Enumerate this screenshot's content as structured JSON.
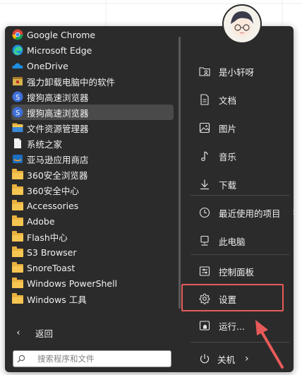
{
  "start_menu": {
    "apps": [
      {
        "label": "Google Chrome",
        "icon": "chrome-icon"
      },
      {
        "label": "Microsoft Edge",
        "icon": "edge-icon"
      },
      {
        "label": "OneDrive",
        "icon": "onedrive-icon"
      },
      {
        "label": "强力卸载电脑中的软件",
        "icon": "uninstall-icon"
      },
      {
        "label": "搜狗高速浏览器",
        "icon": "sogou-icon"
      },
      {
        "label": "搜狗高速浏览器",
        "icon": "sogou-icon",
        "selected": true
      },
      {
        "label": "文件资源管理器",
        "icon": "file-explorer-icon"
      },
      {
        "label": "系统之家",
        "icon": "document-icon"
      },
      {
        "label": "亚马逊应用商店",
        "icon": "amazon-appstore-icon"
      },
      {
        "label": "360安全浏览器",
        "icon": "folder-icon"
      },
      {
        "label": "360安全中心",
        "icon": "folder-icon"
      },
      {
        "label": "Accessories",
        "icon": "folder-icon"
      },
      {
        "label": "Adobe",
        "icon": "folder-icon"
      },
      {
        "label": "Flash中心",
        "icon": "folder-icon"
      },
      {
        "label": "S3 Browser",
        "icon": "folder-icon"
      },
      {
        "label": "SnoreToast",
        "icon": "folder-icon"
      },
      {
        "label": "Windows PowerShell",
        "icon": "folder-icon"
      },
      {
        "label": "Windows 工具",
        "icon": "folder-icon"
      }
    ],
    "back_label": "返回",
    "search_placeholder": "搜索程序和文件",
    "right_items": [
      {
        "label": "是小轩呀",
        "icon": "user-folder-icon"
      },
      {
        "label": "文档",
        "icon": "document-icon"
      },
      {
        "label": "图片",
        "icon": "picture-icon"
      },
      {
        "label": "音乐",
        "icon": "music-icon"
      },
      {
        "label": "下载",
        "icon": "download-icon"
      },
      {
        "label": "最近使用的项目",
        "icon": "clock-icon",
        "has_submenu": true
      },
      {
        "label": "此电脑",
        "icon": "computer-icon"
      },
      {
        "label": "控制面板",
        "icon": "control-panel-icon"
      },
      {
        "label": "设置",
        "icon": "gear-icon",
        "highlighted": true
      },
      {
        "label": "运行...",
        "icon": "run-icon"
      }
    ],
    "power_label": "关机",
    "colors": {
      "panel": "#2b2b2b",
      "selected": "#4a4a4a",
      "highlight": "#e85a5a",
      "folder": "#e9b23f"
    }
  }
}
